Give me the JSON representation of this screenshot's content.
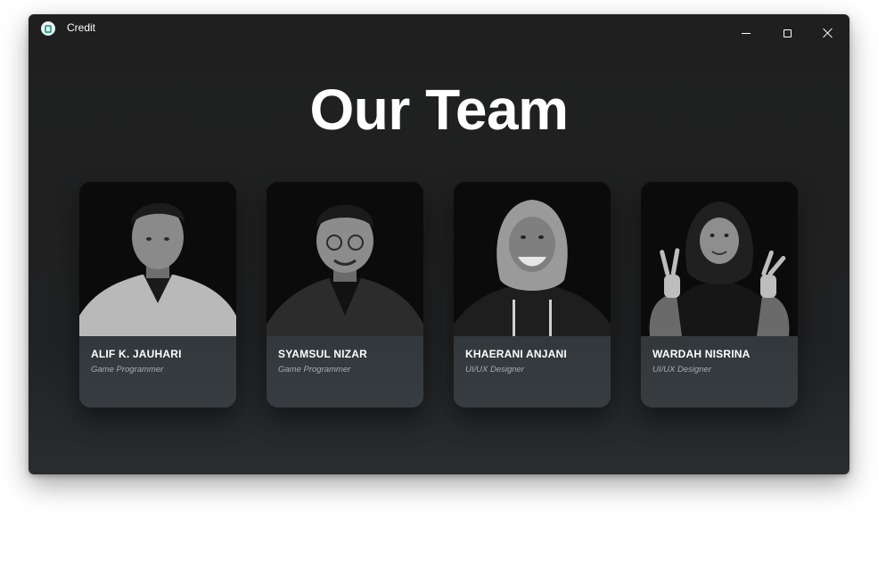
{
  "window": {
    "title": "Credit",
    "icon": "app-logo-icon",
    "controls": [
      "minimize-icon",
      "maximize-icon",
      "close-icon"
    ]
  },
  "page": {
    "heading": "Our Team"
  },
  "team": [
    {
      "name": "ALIF K. JAUHARI",
      "role": "Game Programmer"
    },
    {
      "name": "SYAMSUL NIZAR",
      "role": "Game Programmer"
    },
    {
      "name": "KHAERANI ANJANI",
      "role": "UI/UX Designer"
    },
    {
      "name": "WARDAH NISRINA",
      "role": "UI/UX Designer"
    }
  ]
}
